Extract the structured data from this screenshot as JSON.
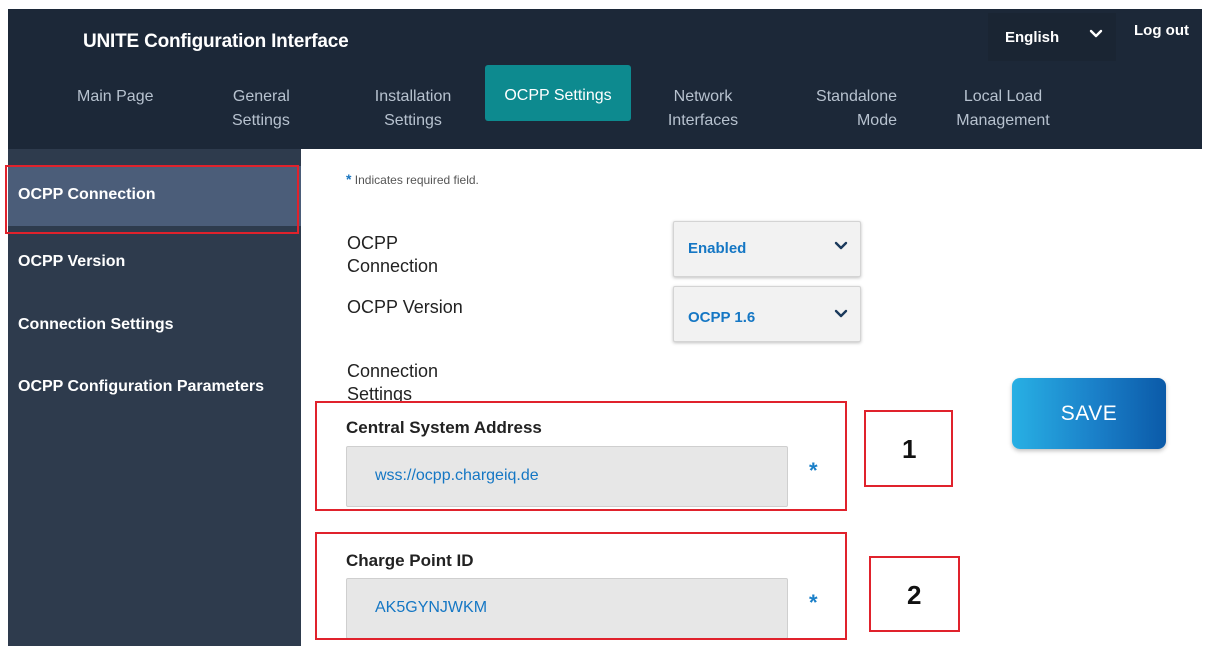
{
  "app": {
    "title": "UNITE Configuration Interface"
  },
  "header": {
    "language": "English",
    "logout": "Log out"
  },
  "nav": {
    "main_page": "Main Page",
    "general_1": "General",
    "general_2": "Settings",
    "installation_1": "Installation",
    "installation_2": "Settings",
    "ocpp": "OCPP Settings",
    "network_1": "Network",
    "network_2": "Interfaces",
    "standalone_1": "Standalone",
    "standalone_2": "Mode",
    "local_1": "Local Load",
    "local_2": "Management"
  },
  "sidebar": {
    "items": [
      "OCPP Connection",
      "OCPP Version",
      "Connection Settings",
      "OCPP Configuration Parameters"
    ],
    "active_index": 0
  },
  "form": {
    "required_note_star": "*",
    "required_note": "Indicates required field.",
    "ocpp_connection_label_1": "OCPP",
    "ocpp_connection_label_2": "Connection",
    "ocpp_connection_value": "Enabled",
    "ocpp_version_label": "OCPP Version",
    "ocpp_version_value": "OCPP 1.6",
    "connection_settings_label_1": "Connection",
    "connection_settings_label_2": "Settings",
    "central_system_address_label": "Central System Address",
    "central_system_address_value": "wss://ocpp.chargeiq.de",
    "charge_point_id_label": "Charge Point ID",
    "charge_point_id_value": "AK5GYNJWKM",
    "required_marker": "*",
    "save_label": "SAVE"
  },
  "callouts": {
    "one": "1",
    "two": "2"
  },
  "colors": {
    "header_bg": "#1c2838",
    "sidebar_bg": "#2e3b4d",
    "sidebar_active": "#4b5d79",
    "nav_active": "#0d8a8f",
    "accent_blue": "#1577c4",
    "highlight_red": "#e0222c"
  },
  "icons": {
    "language_dropdown": "chevron-down-icon",
    "select_dropdown": "chevron-down-icon"
  }
}
